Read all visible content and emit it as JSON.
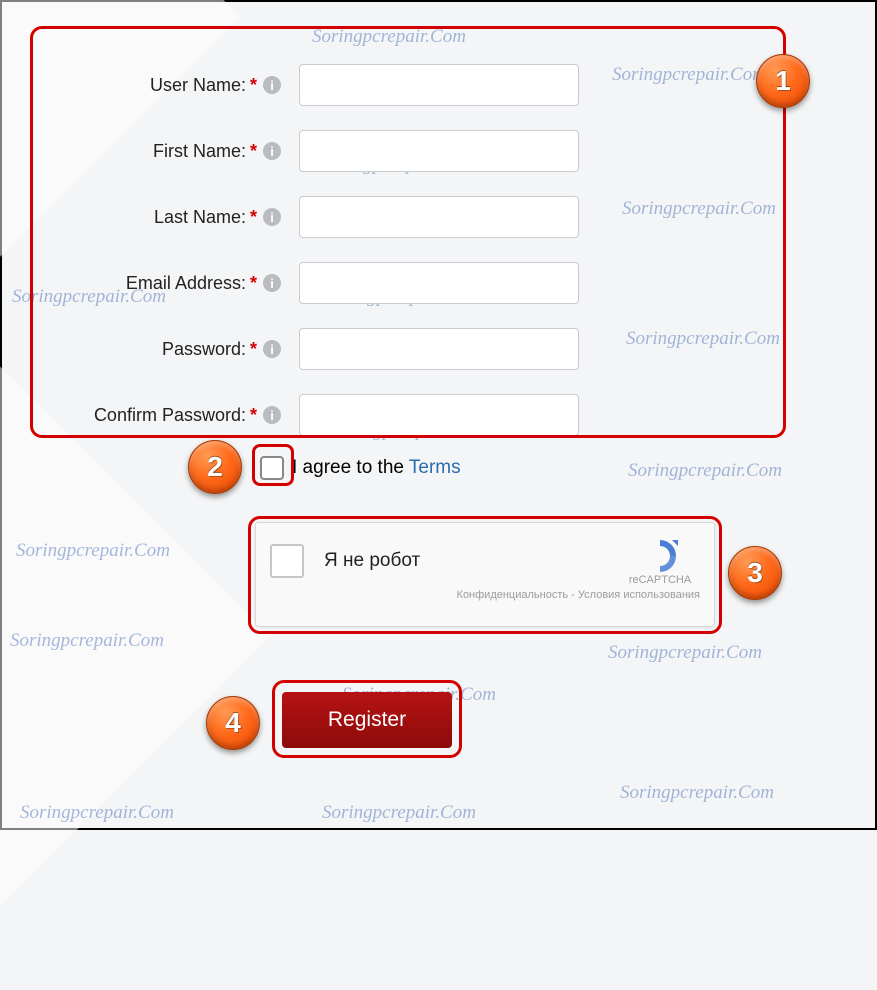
{
  "watermark": "Soringpcrepair.Com",
  "fields": [
    {
      "label": "User Name:"
    },
    {
      "label": "First Name:"
    },
    {
      "label": "Last Name:"
    },
    {
      "label": "Email Address:"
    },
    {
      "label": "Password:"
    },
    {
      "label": "Confirm Password:"
    }
  ],
  "required_marker": "*",
  "info_glyph": "i",
  "agree": {
    "pre": "I agree to the ",
    "link": "Terms"
  },
  "captcha": {
    "label": "Я не робот",
    "brand": "reCAPTCHA",
    "foot_privacy": "Конфиденциальность",
    "foot_sep": " - ",
    "foot_terms": "Условия использования"
  },
  "register_label": "Register",
  "badges": [
    "1",
    "2",
    "3",
    "4"
  ]
}
